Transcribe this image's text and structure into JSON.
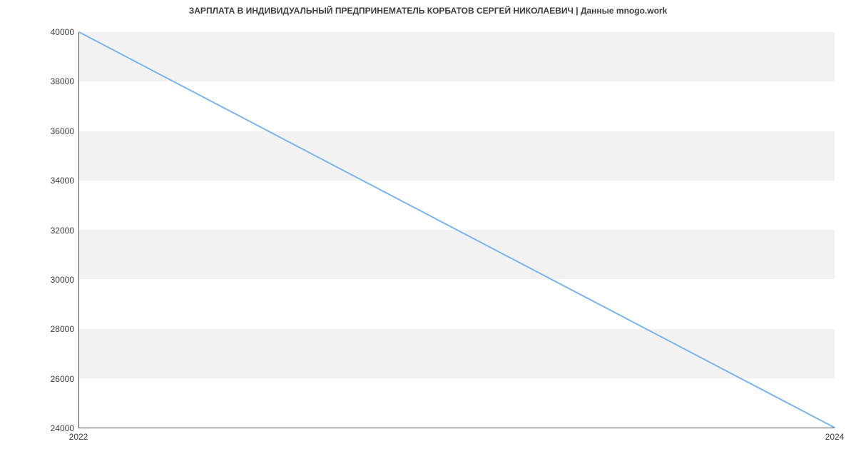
{
  "chart_data": {
    "type": "line",
    "title": "ЗАРПЛАТА В ИНДИВИДУАЛЬНЫЙ ПРЕДПРИНЕМАТЕЛЬ КОРБАТОВ СЕРГЕЙ НИКОЛАЕВИЧ | Данные mnogo.work",
    "x": [
      2022,
      2024
    ],
    "values": [
      40000,
      24000
    ],
    "xlabel": "",
    "ylabel": "",
    "xlim": [
      2022,
      2024
    ],
    "ylim": [
      24000,
      40000
    ],
    "y_ticks": [
      24000,
      26000,
      28000,
      30000,
      32000,
      34000,
      36000,
      38000,
      40000
    ],
    "x_ticks": [
      2022,
      2024
    ],
    "line_color": "#7cb5ec",
    "band_color": "#f2f2f2"
  }
}
